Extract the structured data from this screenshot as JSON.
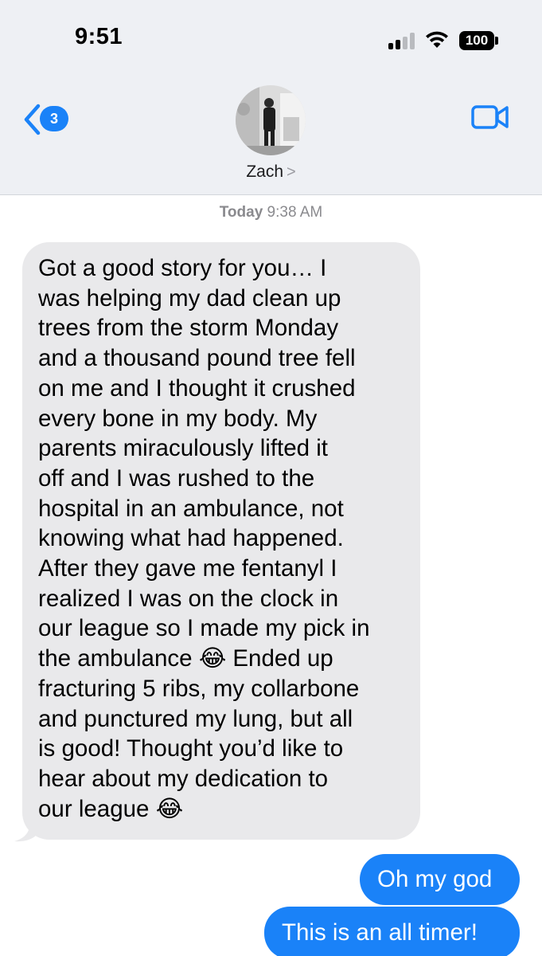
{
  "status_bar": {
    "time": "9:51",
    "battery": "100",
    "signal_icon": "cellular-signal-icon",
    "wifi_icon": "wifi-icon"
  },
  "nav": {
    "back_icon": "chevron-left-icon",
    "unread_count": "3",
    "video_icon": "video-camera-icon",
    "contact_name": "Zach",
    "contact_chevron": ">"
  },
  "conversation": {
    "timestamp_day": "Today",
    "timestamp_time": "9:38 AM",
    "incoming_message": {
      "lines": [
        "Got a good story for you… I",
        "was helping my dad clean up",
        "trees from the storm Monday",
        "and a thousand pound tree fell",
        "on me and I thought it crushed",
        "every bone in my body. My",
        "parents miraculously lifted it",
        "off and I was rushed to the",
        "hospital in an ambulance, not",
        "knowing what had happened.",
        "After they gave me fentanyl I",
        "realized I was on the clock in",
        "our league so I made my pick in",
        "the ambulance 😂 Ended up",
        "fracturing 5 ribs, my collarbone",
        "and punctured my lung, but all",
        "is good! Thought you’d like to",
        "hear about my dedication to",
        "our league 😂"
      ]
    },
    "outgoing_messages": [
      "Oh my god",
      "This is an all timer!"
    ]
  },
  "colors": {
    "imessage_blue": "#1a82f8",
    "incoming_gray": "#e9e9eb",
    "header_bg": "#eef0f4"
  }
}
